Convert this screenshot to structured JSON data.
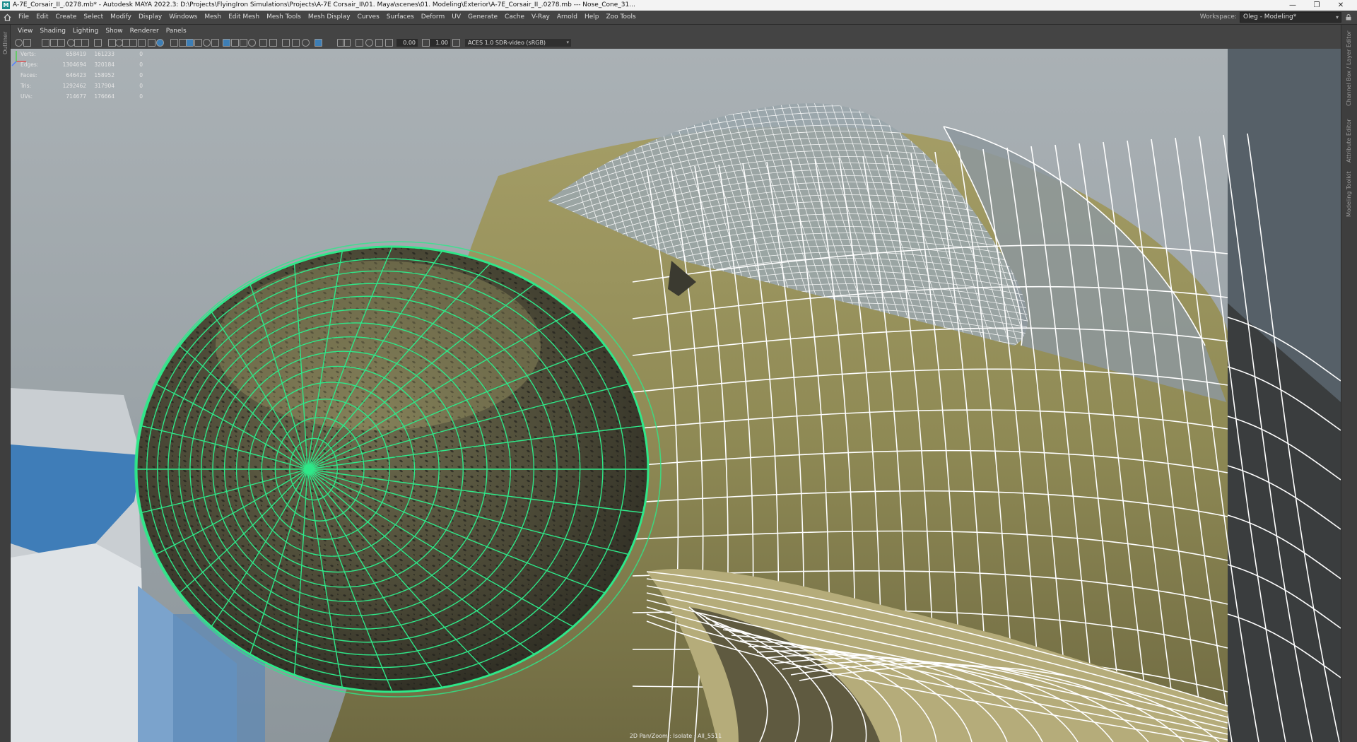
{
  "window": {
    "title": "A-7E_Corsair_II_.0278.mb* - Autodesk MAYA 2022.3: D:\\Projects\\FlyingIron Simulations\\Projects\\A-7E Corsair_II\\01. Maya\\scenes\\01. Modeling\\Exterior\\A-7E_Corsair_II_.0278.mb  ---  Nose_Cone_31...",
    "minimize": "—",
    "restore": "❐",
    "close": "✕"
  },
  "menubar": {
    "items": [
      "File",
      "Edit",
      "Create",
      "Select",
      "Modify",
      "Display",
      "Windows",
      "Mesh",
      "Edit Mesh",
      "Mesh Tools",
      "Mesh Display",
      "Curves",
      "Surfaces",
      "Deform",
      "UV",
      "Generate",
      "Cache",
      "V-Ray",
      "Arnold",
      "Help",
      "Zoo Tools"
    ],
    "workspace_label": "Workspace:",
    "workspace_value": "Oleg - Modeling*"
  },
  "panel_menu": {
    "items": [
      "View",
      "Shading",
      "Lighting",
      "Show",
      "Renderer",
      "Panels"
    ]
  },
  "toolbar": {
    "exposure": "0.00",
    "gamma": "1.00",
    "color_space": "ACES 1.0 SDR-video (sRGB)"
  },
  "hud": {
    "rows": [
      {
        "label": "Verts:",
        "v1": "658419",
        "v2": "161233",
        "v3": "0"
      },
      {
        "label": "Edges:",
        "v1": "1304694",
        "v2": "320184",
        "v3": "0"
      },
      {
        "label": "Faces:",
        "v1": "646423",
        "v2": "158952",
        "v3": "0"
      },
      {
        "label": "Tris:",
        "v1": "1292462",
        "v2": "317904",
        "v3": "0"
      },
      {
        "label": "UVs:",
        "v1": "714677",
        "v2": "176664",
        "v3": "0"
      }
    ]
  },
  "viewport_status": "2D Pan/Zoom : Isolate : All_5511",
  "side_tabs": {
    "left": [
      "Outliner"
    ],
    "right": [
      "Channel Box / Layer Editor",
      "Attribute Editor",
      "Modeling Toolkit"
    ]
  },
  "colors": {
    "selection_wire": "#2ee889",
    "wire": "#ffffff",
    "fuselage": "#8f8a55",
    "nose_dark": "#3a3a30",
    "sky": "#9aa3a8"
  },
  "icons": [
    "maya-logo",
    "home-icon",
    "lock-icon",
    "axis-gizmo-icon"
  ]
}
